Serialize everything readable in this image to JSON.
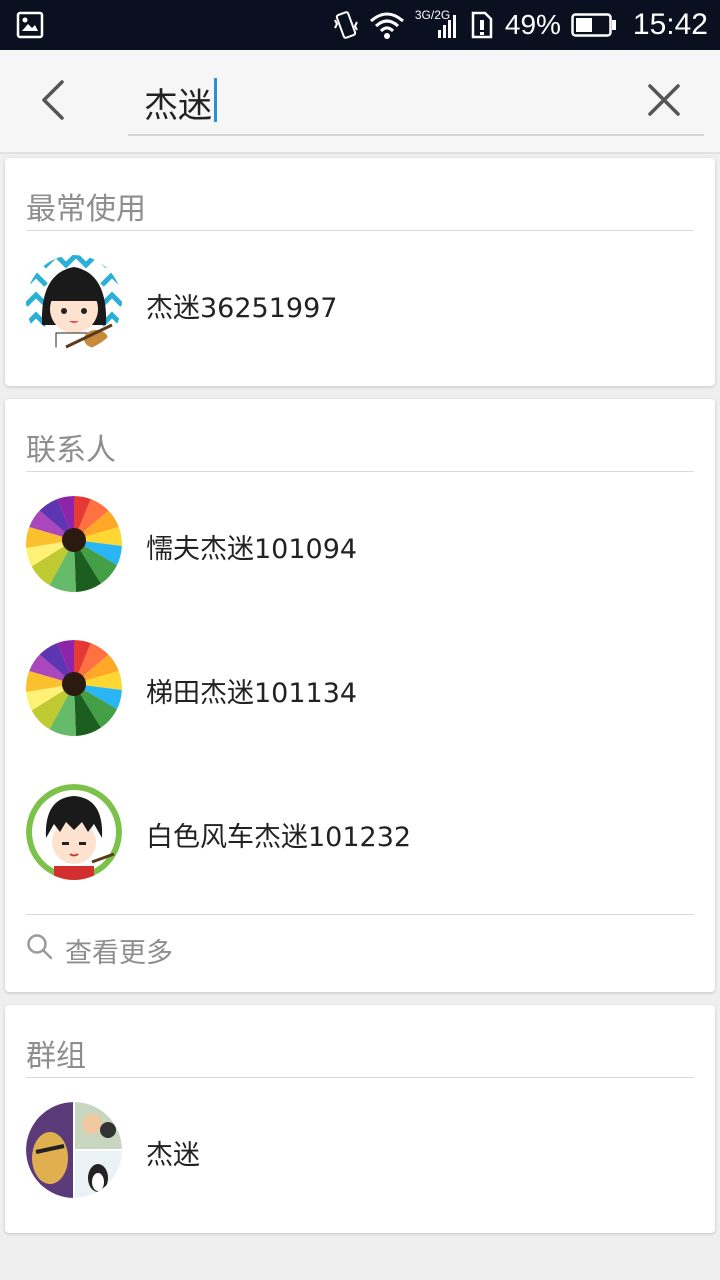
{
  "status_bar": {
    "network": "3G/2G",
    "battery": "49%",
    "time": "15:42",
    "icons": [
      "screenshot-icon",
      "vibrate-icon",
      "wifi-icon",
      "signal-icon",
      "sim-alert-icon",
      "battery-icon"
    ]
  },
  "search": {
    "query": "杰迷",
    "icons": {
      "back": "back-arrow-icon",
      "clear": "close-icon"
    }
  },
  "sections": {
    "frequent": {
      "title": "最常使用",
      "items": [
        {
          "label": "杰迷36251997",
          "avatar": "girl-guitar-avatar"
        }
      ]
    },
    "contacts": {
      "title": "联系人",
      "items": [
        {
          "label": "懦夫杰迷101094",
          "avatar": "colored-pencils-avatar"
        },
        {
          "label": "梯田杰迷101134",
          "avatar": "colored-pencils-avatar"
        },
        {
          "label": "白色风车杰迷101232",
          "avatar": "boy-guitar-avatar"
        }
      ],
      "more_label": "查看更多"
    },
    "groups": {
      "title": "群组",
      "items": [
        {
          "label": "杰迷",
          "avatar": "group-collage-avatar"
        }
      ]
    }
  },
  "colors": {
    "status_bar": "#0b1020",
    "accent_caret": "#2a8fd8",
    "section_title": "#8e8e8e",
    "background": "#efefef"
  }
}
